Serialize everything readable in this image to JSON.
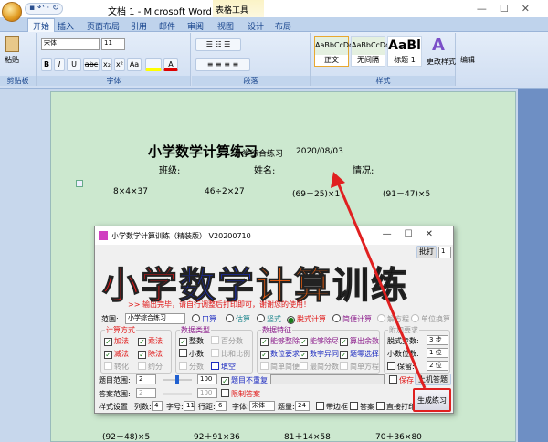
{
  "window": {
    "title": "文档 1 - Microsoft Word",
    "context_tab": "表格工具",
    "controls": "—☐✕",
    "qat": "▪ ↶ · ↻"
  },
  "tabs": [
    "开始",
    "插入",
    "页面布局",
    "引用",
    "邮件",
    "审阅",
    "视图",
    "设计",
    "布局"
  ],
  "ribbon": {
    "clipboard": {
      "label": "剪贴板",
      "paste": "粘贴"
    },
    "font": {
      "label": "字体",
      "name": "宋体",
      "size": "11",
      "buttons": [
        "B",
        "I",
        "U",
        "abc",
        "x₂",
        "x²",
        "Aa",
        "A",
        "A"
      ]
    },
    "paragraph": {
      "label": "段落"
    },
    "styles": {
      "label": "样式",
      "items": [
        {
          "preview": "AaBbCcDd",
          "name": "正文"
        },
        {
          "preview": "AaBbCcDd",
          "name": "无间隔"
        },
        {
          "preview": "AaBl",
          "name": "标题 1"
        }
      ],
      "change": "更改样式"
    },
    "edit": {
      "label": "编辑"
    }
  },
  "document": {
    "title": "小学数学计算练习",
    "subtitle": "小学综合练习",
    "date": "2020/08/03",
    "fields": [
      "班级:",
      "姓名:",
      "情况:"
    ],
    "row1": [
      "8×4×37",
      "46÷2×27",
      "(69－25)×1",
      "(91－47)×5"
    ],
    "row2": [
      "(92－48)×5",
      "92＋91×36",
      "81＋14×58",
      "70＋36×80"
    ]
  },
  "dialog": {
    "title": "小学数学计算训练（精装版） V20200710",
    "print_btn": "批打",
    "print_count": "1",
    "logo": [
      "小学",
      "数学",
      "计算",
      "训练"
    ],
    "message": ">> 输出完毕，请自行调整后打印即可，谢谢您的使用！",
    "range_label": "范围:",
    "range_value": "小学综合练习",
    "modes": [
      {
        "label": "口算",
        "on": false
      },
      {
        "label": "估算",
        "on": false
      },
      {
        "label": "竖式",
        "on": false
      },
      {
        "label": "脱式计算",
        "on": true
      },
      {
        "label": "简便计算",
        "on": false
      },
      {
        "label": "解方程",
        "on": false
      },
      {
        "label": "单位换算",
        "on": false
      }
    ],
    "calc": {
      "legend": "计算方式",
      "items": [
        {
          "label": "加法",
          "on": true
        },
        {
          "label": "乘法",
          "on": true
        },
        {
          "label": "减法",
          "on": true
        },
        {
          "label": "除法",
          "on": true
        },
        {
          "label": "转化",
          "on": false
        },
        {
          "label": "约分",
          "on": false
        }
      ]
    },
    "dtype": {
      "legend": "数据类型",
      "items": [
        {
          "label": "整数",
          "on": true
        },
        {
          "label": "百分数",
          "on": false
        },
        {
          "label": "小数",
          "on": false
        },
        {
          "label": "比和比例",
          "on": false
        },
        {
          "label": "分数",
          "on": false
        },
        {
          "label": "填空",
          "on": false
        }
      ]
    },
    "feature": {
      "legend": "数据特征",
      "items": [
        {
          "label": "能够整除",
          "on": true
        },
        {
          "label": "能够除尽",
          "on": true
        },
        {
          "label": "算出余数",
          "on": true
        },
        {
          "label": "数位要求",
          "on": true
        },
        {
          "label": "数字异同",
          "on": true
        },
        {
          "label": "题零选择",
          "on": true
        },
        {
          "label": "简单简便",
          "on": false
        },
        {
          "label": "最简分数",
          "on": false
        },
        {
          "label": "简单方程",
          "on": false
        }
      ]
    },
    "extra": {
      "legend": "附加要求",
      "steps_label": "脱式步数:",
      "steps": "3 步",
      "decimals_label": "小数位数:",
      "decimals": "1 位",
      "keep_label": "保留:",
      "keep": "2 位"
    },
    "q_range": {
      "label": "题目范围:",
      "min": "2",
      "max": "100",
      "no_repeat": "题目不重复",
      "slider": 0.02
    },
    "a_range": {
      "label": "答案范围:",
      "min": "2",
      "max": "100",
      "limit": "限制答案"
    },
    "keep_btn": "保存",
    "answer_btn": "上机答题",
    "generate_btn": "生成练习",
    "style_row": {
      "label": "样式设置",
      "cols_label": "列数:",
      "cols": "4",
      "font_size_label": "字号:",
      "font_size": "11",
      "spacing_label": "行距:",
      "spacing": "6",
      "font_label": "字体:",
      "font": "宋体",
      "count_label": "题量:",
      "count": "24",
      "border": "带边框",
      "answer": "答案",
      "direct_print": "直接打印"
    }
  }
}
